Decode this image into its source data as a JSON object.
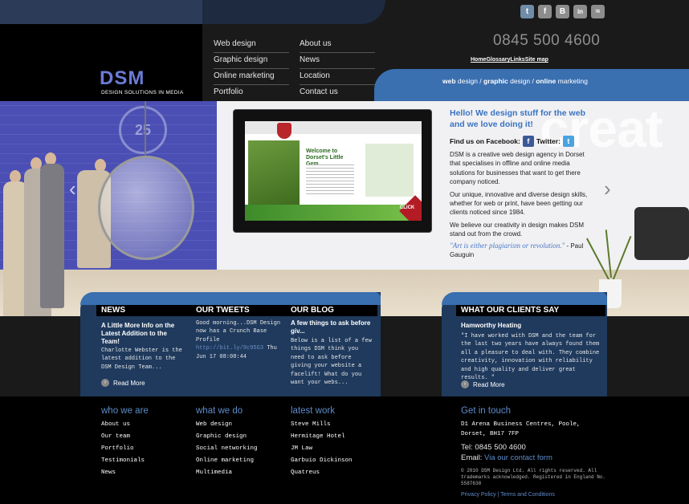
{
  "brand": {
    "logo_text": "DSM",
    "logo_tagline": "DESIGN SOLUTIONS IN MEDIA",
    "phone": "0845 500 4600",
    "accent": "#3a6fb0",
    "dark_band": "#1f3a5d"
  },
  "social_icons": [
    {
      "name": "twitter-icon",
      "glyph": "t",
      "color": "#6f8ca8"
    },
    {
      "name": "facebook-icon",
      "glyph": "f",
      "color": "#8d8d8d"
    },
    {
      "name": "blogger-icon",
      "glyph": "B",
      "color": "#8d8d8d"
    },
    {
      "name": "linkedin-icon",
      "glyph": "in",
      "color": "#8d8d8d"
    },
    {
      "name": "rss-icon",
      "glyph": "≈",
      "color": "#8d8d8d"
    }
  ],
  "top_links": {
    "text": "HomeGlossaryLinksSite map"
  },
  "nav": {
    "web_design": "Web design",
    "graphic_design": "Graphic design",
    "online_marketing": "Online marketing",
    "portfolio": "Portfolio",
    "about_us": "About us",
    "news": "News",
    "location": "Location",
    "contact_us": "Contact us"
  },
  "tagline": {
    "a": "web",
    "a2": " design / ",
    "b": "graphic",
    "b2": " design / ",
    "c": "online",
    "c2": " marketing"
  },
  "hero": {
    "badge": "25",
    "watermark": "creat",
    "prev_arrow": "‹",
    "next_arrow": "›",
    "intro_heading": "Hello! We design stuff for the web and we love doing it!",
    "find_us": "Find us on Facebook:",
    "twitter_label": "Twitter:",
    "p1": "DSM is a creative web design agency in Dorset that specialises in offline and online media solutions for businesses that want to get there company noticed.",
    "p2": "Our unique, innovative and diverse design skills, whether for web or print, have been getting our clients noticed since 1984.",
    "p3": "We believe our creativity in design makes DSM stand out from the crowd.",
    "quote": "\"Art is either plagiarism or revolution.\"",
    "quote_author": " - Paul Gauguin",
    "screen_title": "Welcome to Dorset's Little Gem",
    "screen_click": "CLICK ME"
  },
  "news": {
    "heading": "NEWS",
    "title": "A Little More Info on the Latest Addition to the Team!",
    "body": "Charlotte Webster is the latest addition to the DSM Design Team...",
    "read_more": "Read More"
  },
  "tweets": {
    "heading": "OUR TWEETS",
    "body1": "Good morning...DSM Design now has a Crunch Base Profile",
    "link": "http://bit.ly/9c95G3",
    "body2": " Thu Jun 17 08:08:44"
  },
  "blog": {
    "heading": "OUR BLOG",
    "title": "A few things to ask before giv...",
    "body": "Below is a list of a few things DSM think you need to ask before giving your website a facelift! What do you want your webs..."
  },
  "clients": {
    "heading": "WHAT OUR CLIENTS SAY",
    "name": "Hamworthy Heating",
    "quote": "\"I have worked with DSM and the team for the last two years have always found them all a pleasure to deal with. They combine creativity, innovation with reliability and high quality and deliver great results. \"",
    "read_more": "Read More"
  },
  "footer": {
    "who_we_are": {
      "heading": "who we are",
      "items": [
        "About us",
        "Our team",
        "Portfolio",
        "Testimonials",
        "News"
      ]
    },
    "what_we_do": {
      "heading": "what we do",
      "items": [
        "Web design",
        "Graphic design",
        "Social networking",
        "Online marketing",
        "Multimedia"
      ]
    },
    "latest_work": {
      "heading": "latest work",
      "items": [
        "Steve Mills",
        "Hermitage Hotel",
        "JM Law",
        "Garbuio Dickinson",
        "Quatreus"
      ]
    },
    "get_in_touch": {
      "heading": "Get in touch",
      "address": "D1 Arena Business Centres, Poole, Dorset, BH17 7FP",
      "tel": "Tel: 0845 500 4600",
      "email_label": "Email: ",
      "email_link": "Via our contact form",
      "copyright": "© 2010 DSM Design Ltd. All rights reserved. All trademarks acknowledged. Registered in England No. 5587638",
      "legal": "Privacy Policy | Terms and Conditions"
    }
  }
}
